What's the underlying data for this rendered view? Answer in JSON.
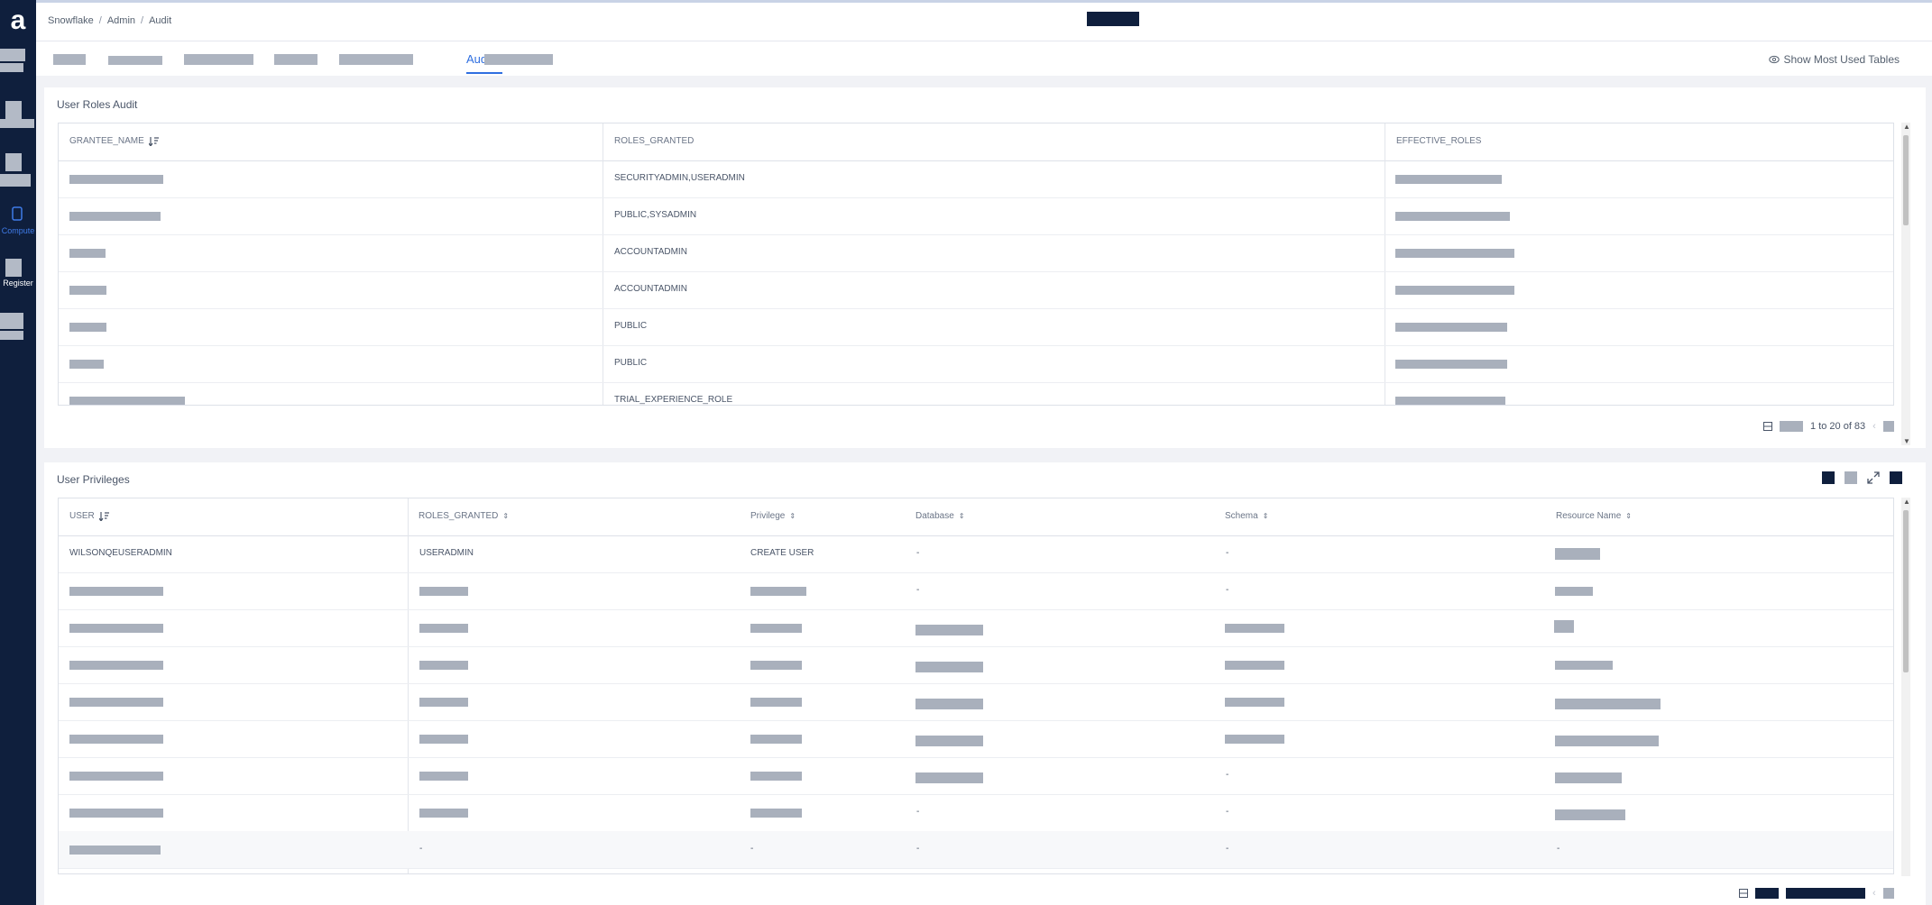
{
  "breadcrumb": [
    "Snowflake",
    "Admin",
    "Audit"
  ],
  "tabs": {
    "active_label": "Audit"
  },
  "show_most_used": "Show Most Used Tables",
  "sidebar": {
    "items": [
      {
        "label": "Compute"
      },
      {
        "label": "Register"
      }
    ]
  },
  "user_roles": {
    "title": "User Roles Audit",
    "columns": [
      "GRANTEE_NAME",
      "ROLES_GRANTED",
      "EFFECTIVE_ROLES"
    ],
    "rows": [
      {
        "roles_granted": "SECURITYADMIN,USERADMIN"
      },
      {
        "roles_granted": "PUBLIC,SYSADMIN"
      },
      {
        "roles_granted": "ACCOUNTADMIN"
      },
      {
        "roles_granted": "ACCOUNTADMIN"
      },
      {
        "roles_granted": "PUBLIC"
      },
      {
        "roles_granted": "PUBLIC"
      },
      {
        "roles_granted": "TRIAL_EXPERIENCE_ROLE"
      }
    ],
    "pager": "1 to 20 of 83"
  },
  "user_privileges": {
    "title": "User Privileges",
    "columns": [
      "USER",
      "ROLES_GRANTED",
      "Privilege",
      "Database",
      "Schema",
      "Resource Name"
    ],
    "first_row": {
      "user": "WILSONQEUSERADMIN",
      "roles_granted": "USERADMIN",
      "privilege": "CREATE USER",
      "database": "-",
      "schema": "-"
    },
    "dash": "-"
  },
  "colors": {
    "sidebar": "#0f1f3d",
    "accent": "#2f6fe0",
    "redacted": "#a9b0bc"
  }
}
